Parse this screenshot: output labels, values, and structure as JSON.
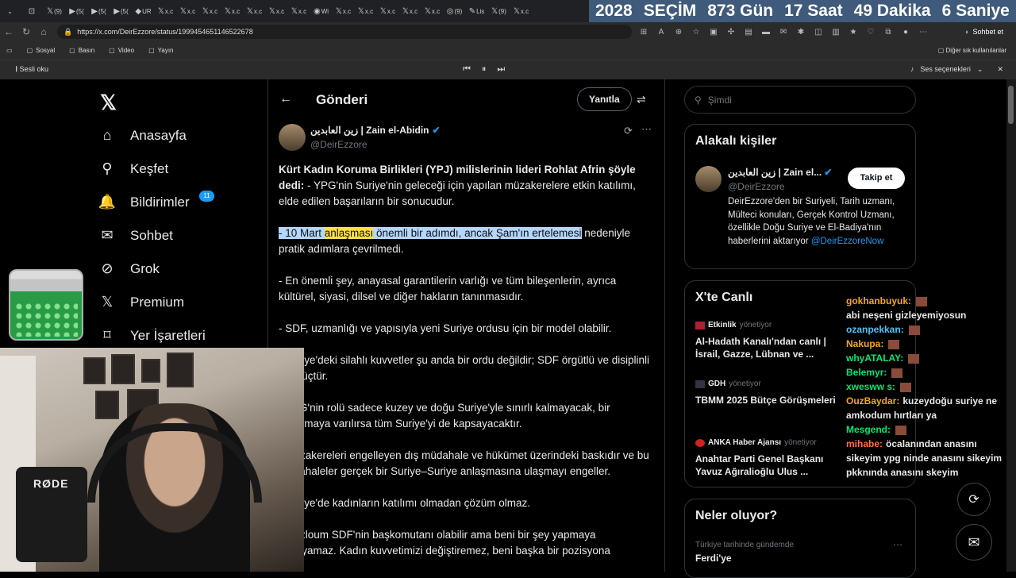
{
  "browser": {
    "tabs": [
      {
        "icon": "⊡",
        "label": ""
      },
      {
        "icon": "𝕏",
        "label": "(9)"
      },
      {
        "icon": "▶",
        "label": "(5("
      },
      {
        "icon": "▶",
        "label": "(5("
      },
      {
        "icon": "▶",
        "label": "(5("
      },
      {
        "icon": "◆",
        "label": "UR"
      },
      {
        "icon": "𝕏",
        "label": "x.c"
      },
      {
        "icon": "𝕏",
        "label": "x.c"
      },
      {
        "icon": "𝕏",
        "label": "x.c"
      },
      {
        "icon": "𝕏",
        "label": "x.c"
      },
      {
        "icon": "𝕏",
        "label": "x.c"
      },
      {
        "icon": "𝕏",
        "label": "x.c"
      },
      {
        "icon": "𝕏",
        "label": "x.c"
      },
      {
        "icon": "◉",
        "label": "Wi"
      },
      {
        "icon": "𝕏",
        "label": "x.c"
      },
      {
        "icon": "𝕏",
        "label": "x.c"
      },
      {
        "icon": "𝕏",
        "label": "x.c"
      },
      {
        "icon": "𝕏",
        "label": "x.c"
      },
      {
        "icon": "𝕏",
        "label": "x.c"
      },
      {
        "icon": "◎",
        "label": "(9)"
      },
      {
        "icon": "✎",
        "label": "Lis"
      },
      {
        "icon": "𝕏",
        "label": "(9)"
      },
      {
        "icon": "𝕏",
        "label": "x.c"
      }
    ],
    "countdown": {
      "year": "2028",
      "label": "SEÇİM",
      "days": "873 Gün",
      "hours": "17 Saat",
      "minutes": "49 Dakika",
      "seconds": "6 Saniye"
    },
    "url": "https://x.com/DeirEzzore/status/1999454651146522678",
    "chat_button": "Sohbet et",
    "bookmarks": [
      "Sosyal",
      "Basın",
      "Video",
      "Yayın"
    ],
    "other_bookmarks": "Diğer sık kullanılanlar",
    "read_aloud": "Sesli oku",
    "voice_options": "Ses seçenekleri"
  },
  "nav": {
    "items": [
      {
        "icon": "⌂",
        "label": "Anasayfa"
      },
      {
        "icon": "⚲",
        "label": "Keşfet"
      },
      {
        "icon": "🔔",
        "label": "Bildirimler"
      },
      {
        "icon": "✉",
        "label": "Sohbet"
      },
      {
        "icon": "⊘",
        "label": "Grok"
      },
      {
        "icon": "𝕏",
        "label": "Premium"
      },
      {
        "icon": "⌑",
        "label": "Yer İşaretleri"
      }
    ],
    "notif_count": "11"
  },
  "post": {
    "header_title": "Gönderi",
    "reply_label": "Yanıtla",
    "author_name": "زين العابدين | Zain el-Abidin",
    "author_handle": "@DeirEzzore",
    "lead_bold": "Kürt Kadın Koruma Birlikleri (YPJ) milislerinin lideri Rohlat Afrin şöyle dedi:",
    "lead_rest": " - YPG'nin Suriye'nin geleceği için yapılan müzakerelere etkin katılımı, elde edilen başarıların bir sonucudur.",
    "p2_a": "- 10 Mart ",
    "p2_hl": "anlaşması",
    "p2_b": " önemli bir adımdı, ancak Şam'ın ertelemesi",
    "p2_c": " nedeniyle pratik adımlara çevrilmedi.",
    "p3": "- En önemli şey, anayasal garantilerin varlığı ve tüm bileşenlerin, ayrıca kültürel, siyasi, dilsel ve diğer hakların tanınmasıdır.",
    "p4": "- SDF, uzmanlığı ve yapısıyla yeni Suriye ordusu için bir model olabilir.",
    "p5": "- Suriye'deki silahlı kuvvetler şu anda bir ordu değildir; SDF örgütlü ve disiplinli tek güçtür.",
    "p6": "- YPG'nin rolü sadece kuzey ve doğu Suriye'yle sınırlı kalmayacak, bir anlaşmaya varılırsa tüm Suriye'yi de kapsayacaktır.",
    "p7": "- Müzakereleri engelleyen dış müdahale ve hükümet üzerindeki baskıdır ve bu müdahaleler gerçek bir Suriye–Suriye anlaşmasına ulaşmayı engeller.",
    "p8": "- Suriye'de kadınların katılımı olmadan çözüm olmaz.",
    "p9": "- Mazloum SDF'nin başkomutanı olabilir ama beni bir şey yapmaya zorlayamaz. Kadın kuvvetimizi değiştiremez, beni başka bir pozisyona"
  },
  "sidebar": {
    "search_placeholder": "Şimdi",
    "related_title": "Alakalı kişiler",
    "related_name": "زين العابدين | Zain el...",
    "related_handle": "@DeirEzzore",
    "follow_label": "Takip et",
    "related_bio": "DeirEzzore'den bir Suriyeli, Tarih uzmanı, Mülteci konuları, Gerçek Kontrol Uzmanı, özellikle Doğu Suriye ve El-Badiya'nın haberlerini aktarıyor ",
    "related_link": "@DeirEzzoreNow",
    "live_title": "X'te Canlı",
    "live": [
      {
        "source": "Etkinlik",
        "role": "yönetiyor",
        "title": "Al-Hadath Kanalı'ndan canlı | İsrail, Gazze, Lübnan ve ..."
      },
      {
        "source": "GDH",
        "role": "yönetiyor",
        "title": "TBMM 2025 Bütçe Görüşmeleri"
      },
      {
        "source": "ANKA Haber Ajansı",
        "role": "yönetiyor",
        "title": "Anahtar Parti Genel Başkanı Yavuz Ağıralioğlu Ulus ..."
      }
    ],
    "trends_title": "Neler oluyor?",
    "trend_context": "Türkiye tarihinde gündemde",
    "trend_name": "Ferdi'ye"
  },
  "overlay": {
    "mic_brand": "RØDE",
    "chat": [
      {
        "user": "gokhanbuyuk:",
        "color": "#f5a623",
        "text": ""
      },
      {
        "user": "",
        "color": "#e7e9ea",
        "text": "abi neşeni gizleyemiyosun"
      },
      {
        "user": "ozanpekkan:",
        "color": "#4fc3f7",
        "text": ""
      },
      {
        "user": "Nakupa:",
        "color": "#f5a623",
        "text": ""
      },
      {
        "user": "whyATALAY:",
        "color": "#00e676",
        "text": ""
      },
      {
        "user": "Belemyr:",
        "color": "#00e676",
        "text": ""
      },
      {
        "user": "xwesww s:",
        "color": "#00e676",
        "text": ""
      },
      {
        "user": "OuzBaydar:",
        "color": "#f5a623",
        "text": "kuzeydoğu suriye ne amkodum hırtları ya"
      },
      {
        "user": "Mesgend:",
        "color": "#00e676",
        "text": ""
      },
      {
        "user": "mihabe:",
        "color": "#ff7043",
        "text": "öcalanından anasını sikeyim ypg ninde anasını sikeyim pkknında anasını skeyim"
      }
    ]
  }
}
